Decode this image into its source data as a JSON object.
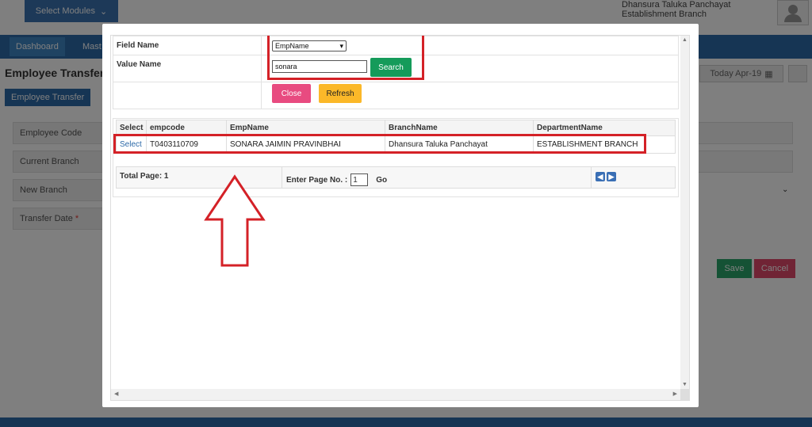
{
  "header": {
    "modules_label": "Select Modules",
    "org_line1": "Dhansura Taluka Panchayat",
    "org_line2": "Establishment Branch"
  },
  "nav": {
    "dashboard": "Dashboard",
    "master": "Mast"
  },
  "page": {
    "title": "Employee Transfer A",
    "today_label": "Today Apr-19",
    "tab": "Employee Transfer",
    "fields": {
      "employee_code": "Employee Code",
      "current_branch": "Current Branch",
      "new_branch": "New Branch",
      "transfer_date": "Transfer Date",
      "required_mark": "*"
    },
    "save": "Save",
    "cancel": "Cancel"
  },
  "modal": {
    "field_name_label": "Field Name",
    "value_name_label": "Value Name",
    "field_select_value": "EmpName",
    "value_input": "sonara",
    "search": "Search",
    "close": "Close",
    "refresh": "Refresh",
    "columns": {
      "select": "Select",
      "empcode": "empcode",
      "empname": "EmpName",
      "branch": "BranchName",
      "department": "DepartmentName"
    },
    "row": {
      "select": "Select",
      "empcode": "T0403110709",
      "empname": "SONARA JAIMIN PRAVINBHAI",
      "branch": "Dhansura Taluka Panchayat",
      "department": "ESTABLISHMENT BRANCH"
    },
    "pager": {
      "total": "Total Page: 1",
      "enter": "Enter Page No. :",
      "page": "1",
      "go": "Go"
    }
  },
  "colors": {
    "highlight": "#d42127",
    "primary": "#2d6aa8"
  }
}
